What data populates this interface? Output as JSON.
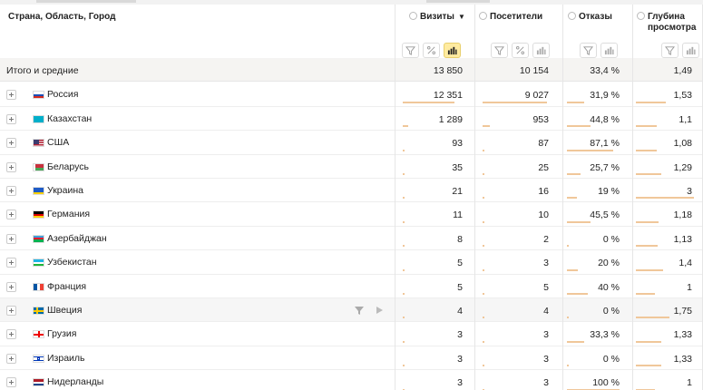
{
  "columns": {
    "dimension": "Страна, Область, Город",
    "visits": "Визиты",
    "visitors": "Посетители",
    "bounces": "Отказы",
    "depth_line1": "Глубина",
    "depth_line2": "просмотра",
    "sort_indicator": "▼"
  },
  "icons": {
    "filter": "filter-icon",
    "percent": "percent-icon",
    "barchart": "bar-chart-icon",
    "help": "help-circle-icon",
    "expand": "plus-icon",
    "play": "play-icon"
  },
  "colors": {
    "bar_fill": "#f0c79a",
    "active_button": "#ffeba0",
    "total_row_bg": "#f5f4f2"
  },
  "total": {
    "label": "Итого и средние",
    "visits": "13 850",
    "visitors": "10 154",
    "bounces": "33,4 %",
    "depth": "1,49"
  },
  "rows": [
    {
      "country": "Россия",
      "visits": "12 351",
      "visitors": "9 027",
      "bounces": "31,9 %",
      "depth": "1,53",
      "v": 12351,
      "u": 9027,
      "b": 31.9,
      "d": 1.53
    },
    {
      "country": "Казахстан",
      "visits": "1 289",
      "visitors": "953",
      "bounces": "44,8 %",
      "depth": "1,1",
      "v": 1289,
      "u": 953,
      "b": 44.8,
      "d": 1.1
    },
    {
      "country": "США",
      "visits": "93",
      "visitors": "87",
      "bounces": "87,1 %",
      "depth": "1,08",
      "v": 93,
      "u": 87,
      "b": 87.1,
      "d": 1.08
    },
    {
      "country": "Беларусь",
      "visits": "35",
      "visitors": "25",
      "bounces": "25,7 %",
      "depth": "1,29",
      "v": 35,
      "u": 25,
      "b": 25.7,
      "d": 1.29
    },
    {
      "country": "Украина",
      "visits": "21",
      "visitors": "16",
      "bounces": "19 %",
      "depth": "3",
      "v": 21,
      "u": 16,
      "b": 19,
      "d": 3
    },
    {
      "country": "Германия",
      "visits": "11",
      "visitors": "10",
      "bounces": "45,5 %",
      "depth": "1,18",
      "v": 11,
      "u": 10,
      "b": 45.5,
      "d": 1.18
    },
    {
      "country": "Азербайджан",
      "visits": "8",
      "visitors": "2",
      "bounces": "0 %",
      "depth": "1,13",
      "v": 8,
      "u": 2,
      "b": 0,
      "d": 1.13
    },
    {
      "country": "Узбекистан",
      "visits": "5",
      "visitors": "3",
      "bounces": "20 %",
      "depth": "1,4",
      "v": 5,
      "u": 3,
      "b": 20,
      "d": 1.4
    },
    {
      "country": "Франция",
      "visits": "5",
      "visitors": "5",
      "bounces": "40 %",
      "depth": "1",
      "v": 5,
      "u": 5,
      "b": 40,
      "d": 1
    },
    {
      "country": "Швеция",
      "visits": "4",
      "visitors": "4",
      "bounces": "0 %",
      "depth": "1,75",
      "v": 4,
      "u": 4,
      "b": 0,
      "d": 1.75
    },
    {
      "country": "Грузия",
      "visits": "3",
      "visitors": "3",
      "bounces": "33,3 %",
      "depth": "1,33",
      "v": 3,
      "u": 3,
      "b": 33.3,
      "d": 1.33
    },
    {
      "country": "Израиль",
      "visits": "3",
      "visitors": "3",
      "bounces": "0 %",
      "depth": "1,33",
      "v": 3,
      "u": 3,
      "b": 0,
      "d": 1.33
    },
    {
      "country": "Нидерланды",
      "visits": "3",
      "visitors": "3",
      "bounces": "100 %",
      "depth": "1",
      "v": 3,
      "u": 3,
      "b": 100,
      "d": 1
    }
  ]
}
